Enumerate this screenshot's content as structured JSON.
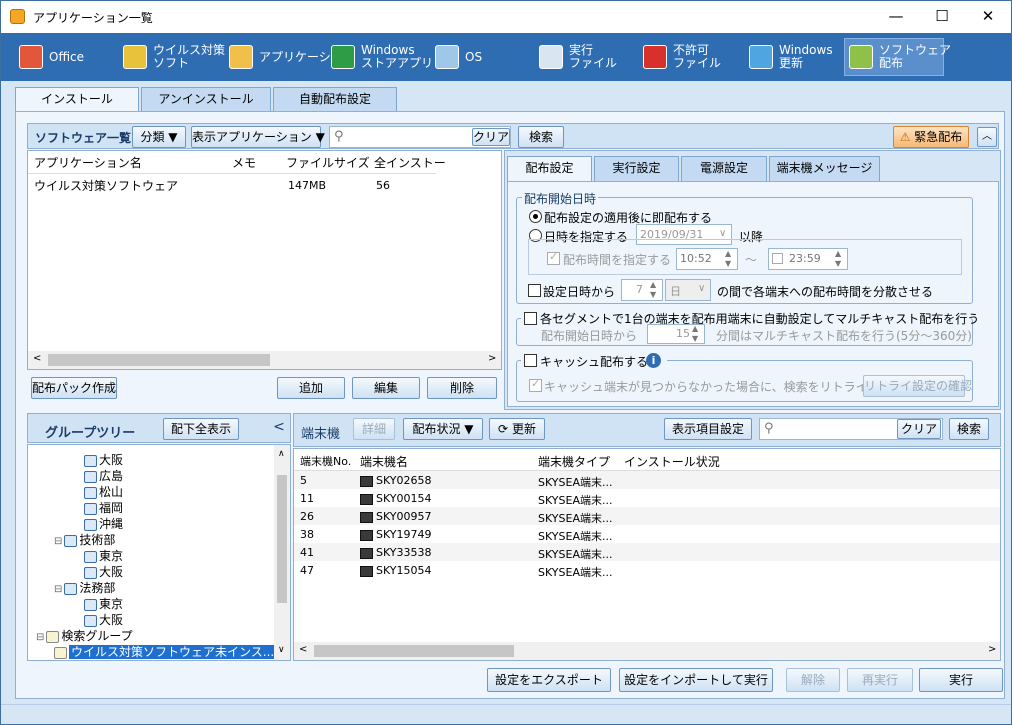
{
  "window": {
    "title": "アプリケーション一覧",
    "min": "—",
    "max": "☐",
    "close": "✕"
  },
  "ribbon": [
    {
      "label": "Office",
      "icon": "office-icon",
      "color": "#e2573b"
    },
    {
      "label": "ウイルス対策\nソフト",
      "icon": "antivirus-icon",
      "color": "#e8c23a"
    },
    {
      "label": "アプリケーション",
      "icon": "application-icon",
      "color": "#f0c04a"
    },
    {
      "label": "Windows\nストアアプリ",
      "icon": "store-icon",
      "color": "#2e9b45"
    },
    {
      "label": "OS",
      "icon": "os-disc-icon",
      "color": "#9fc8e8"
    },
    {
      "label": "実行\nファイル",
      "icon": "exe-file-icon",
      "color": "#d9e6f2"
    },
    {
      "label": "不許可\nファイル",
      "icon": "forbidden-file-icon",
      "color": "#d8312b"
    },
    {
      "label": "Windows\n更新",
      "icon": "windows-update-icon",
      "color": "#4fa5e0"
    },
    {
      "label": "ソフトウェア\n配布",
      "icon": "software-distribution-icon",
      "color": "#8fc14a"
    }
  ],
  "main_tabs": [
    "インストール",
    "アンインストール",
    "自動配布設定"
  ],
  "software": {
    "title": "ソフトウェア一覧",
    "category": "分類 ▼",
    "display_app": "表示アプリケーション ▼",
    "search_placeholder": "",
    "clear": "クリア",
    "search": "検索",
    "emergency": "緊急配布",
    "columns": [
      "アプリケーション名",
      "メモ",
      "ファイルサイズ",
      "全インストー"
    ],
    "rows": [
      {
        "name": "ウイルス対策ソフトウェア",
        "memo": "",
        "size": "147MB",
        "total": "56"
      }
    ],
    "create_pack": "配布パック作成",
    "add": "追加",
    "edit": "編集",
    "delete": "削除"
  },
  "settings": {
    "tabs": [
      "配布設定",
      "実行設定",
      "電源設定",
      "端末機メッセージ"
    ],
    "start_group": "配布開始日時",
    "immediate": "配布設定の適用後に即配布する",
    "specify_date": "日時を指定する",
    "date_value": "2019/09/31",
    "after": "以降",
    "specify_time": "配布時間を指定する",
    "time_from": "10:52",
    "tilde": "〜",
    "time_to": "23:59",
    "spread_prefix": "設定日時から",
    "spread_num": "7",
    "spread_unit": "日",
    "spread_suffix": "の間で各端末への配布時間を分散させる",
    "multicast": "各セグメントで1台の端末を配布用端末に自動設定してマルチキャスト配布を行う",
    "mc_prefix": "配布開始日時から",
    "mc_num": "15",
    "mc_suffix": "分間はマルチキャスト配布を行う(5分〜360分)",
    "cache": "キャッシュ配布する",
    "cache_retry": "キャッシュ端末が見つからなかった場合に、検索をリトライする",
    "retry_btn": "リトライ設定の確認"
  },
  "group": {
    "title": "グループツリー",
    "show_all": "配下全表示",
    "nodes": [
      {
        "label": "大阪",
        "type": "net",
        "level": 3
      },
      {
        "label": "広島",
        "type": "net",
        "level": 3
      },
      {
        "label": "松山",
        "type": "net",
        "level": 3
      },
      {
        "label": "福岡",
        "type": "net",
        "level": 3
      },
      {
        "label": "沖縄",
        "type": "net",
        "level": 3
      },
      {
        "label": "技術部",
        "type": "net",
        "level": 2,
        "exp": "−"
      },
      {
        "label": "東京",
        "type": "net",
        "level": 3
      },
      {
        "label": "大阪",
        "type": "net",
        "level": 3
      },
      {
        "label": "法務部",
        "type": "net",
        "level": 2,
        "exp": "−"
      },
      {
        "label": "東京",
        "type": "net",
        "level": 3
      },
      {
        "label": "大阪",
        "type": "net",
        "level": 3
      },
      {
        "label": "検索グループ",
        "type": "search",
        "level": 1,
        "exp": "−"
      },
      {
        "label": "ウイルス対策ソフトウェア未インス...",
        "type": "search",
        "level": 2,
        "selected": true
      }
    ]
  },
  "terminals": {
    "title": "端末機",
    "detail": "詳細",
    "status": "配布状況 ▼",
    "refresh": "更新",
    "display_items": "表示項目設定",
    "clear": "クリア",
    "search": "検索",
    "columns": [
      "端末機No.",
      "端末機名",
      "端末機タイプ",
      "インストール状況"
    ],
    "rows": [
      {
        "no": "5",
        "name": "SKY02658",
        "type": "SKYSEA端末...",
        "status": ""
      },
      {
        "no": "11",
        "name": "SKY00154",
        "type": "SKYSEA端末...",
        "status": ""
      },
      {
        "no": "26",
        "name": "SKY00957",
        "type": "SKYSEA端末...",
        "status": ""
      },
      {
        "no": "38",
        "name": "SKY19749",
        "type": "SKYSEA端末...",
        "status": ""
      },
      {
        "no": "41",
        "name": "SKY33538",
        "type": "SKYSEA端末...",
        "status": ""
      },
      {
        "no": "47",
        "name": "SKY15054",
        "type": "SKYSEA端末...",
        "status": ""
      }
    ]
  },
  "footer": {
    "export": "設定をエクスポート",
    "import": "設定をインポートして実行",
    "release": "解除",
    "rerun": "再実行",
    "run": "実行"
  }
}
